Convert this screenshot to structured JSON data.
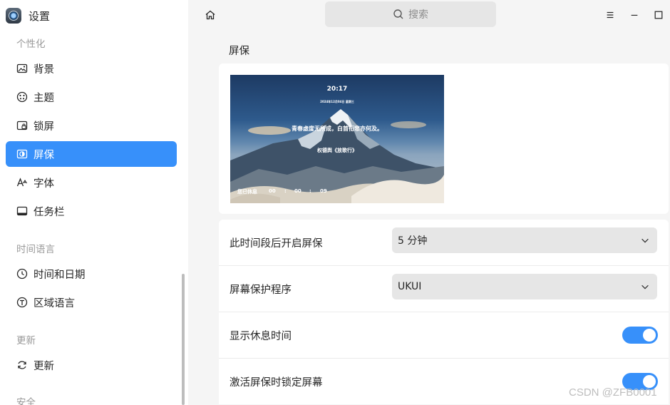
{
  "app": {
    "title": "设置"
  },
  "sidebar": {
    "groups": [
      {
        "title": "个性化"
      },
      {
        "title": "时间语言"
      },
      {
        "title": "更新"
      },
      {
        "title": "安全"
      }
    ],
    "items": [
      {
        "label": "背景",
        "icon": "image-icon"
      },
      {
        "label": "主题",
        "icon": "palette-icon"
      },
      {
        "label": "锁屏",
        "icon": "lock-screen-icon"
      },
      {
        "label": "屏保",
        "icon": "screensaver-icon",
        "active": true
      },
      {
        "label": "字体",
        "icon": "font-icon"
      },
      {
        "label": "任务栏",
        "icon": "taskbar-icon"
      },
      {
        "label": "时间和日期",
        "icon": "clock-icon"
      },
      {
        "label": "区域语言",
        "icon": "region-icon"
      },
      {
        "label": "更新",
        "icon": "refresh-icon"
      }
    ]
  },
  "search": {
    "placeholder": "搜索"
  },
  "main": {
    "title": "屏保",
    "preview": {
      "time": "20:17",
      "date": "2024年12月04日 星期三",
      "quote": "青春虚度无所成，白首衔悲亦何及。",
      "author": "权德舆《放歌行》",
      "rest_label": "您已休息",
      "rest_hours": "00",
      "rest_minutes": "00",
      "rest_seconds": "09"
    },
    "settings": [
      {
        "label": "此时间段后开启屏保",
        "type": "select",
        "value": "5 分钟"
      },
      {
        "label": "屏幕保护程序",
        "type": "select",
        "value": "UKUI"
      },
      {
        "label": "显示休息时间",
        "type": "toggle",
        "on": true
      },
      {
        "label": "激活屏保时锁定屏幕",
        "type": "toggle",
        "on": true
      }
    ]
  },
  "watermark": "CSDN @ZFB0001",
  "colors": {
    "accent": "#3790fa",
    "background": "#f5f5f5",
    "card": "#ffffff"
  }
}
